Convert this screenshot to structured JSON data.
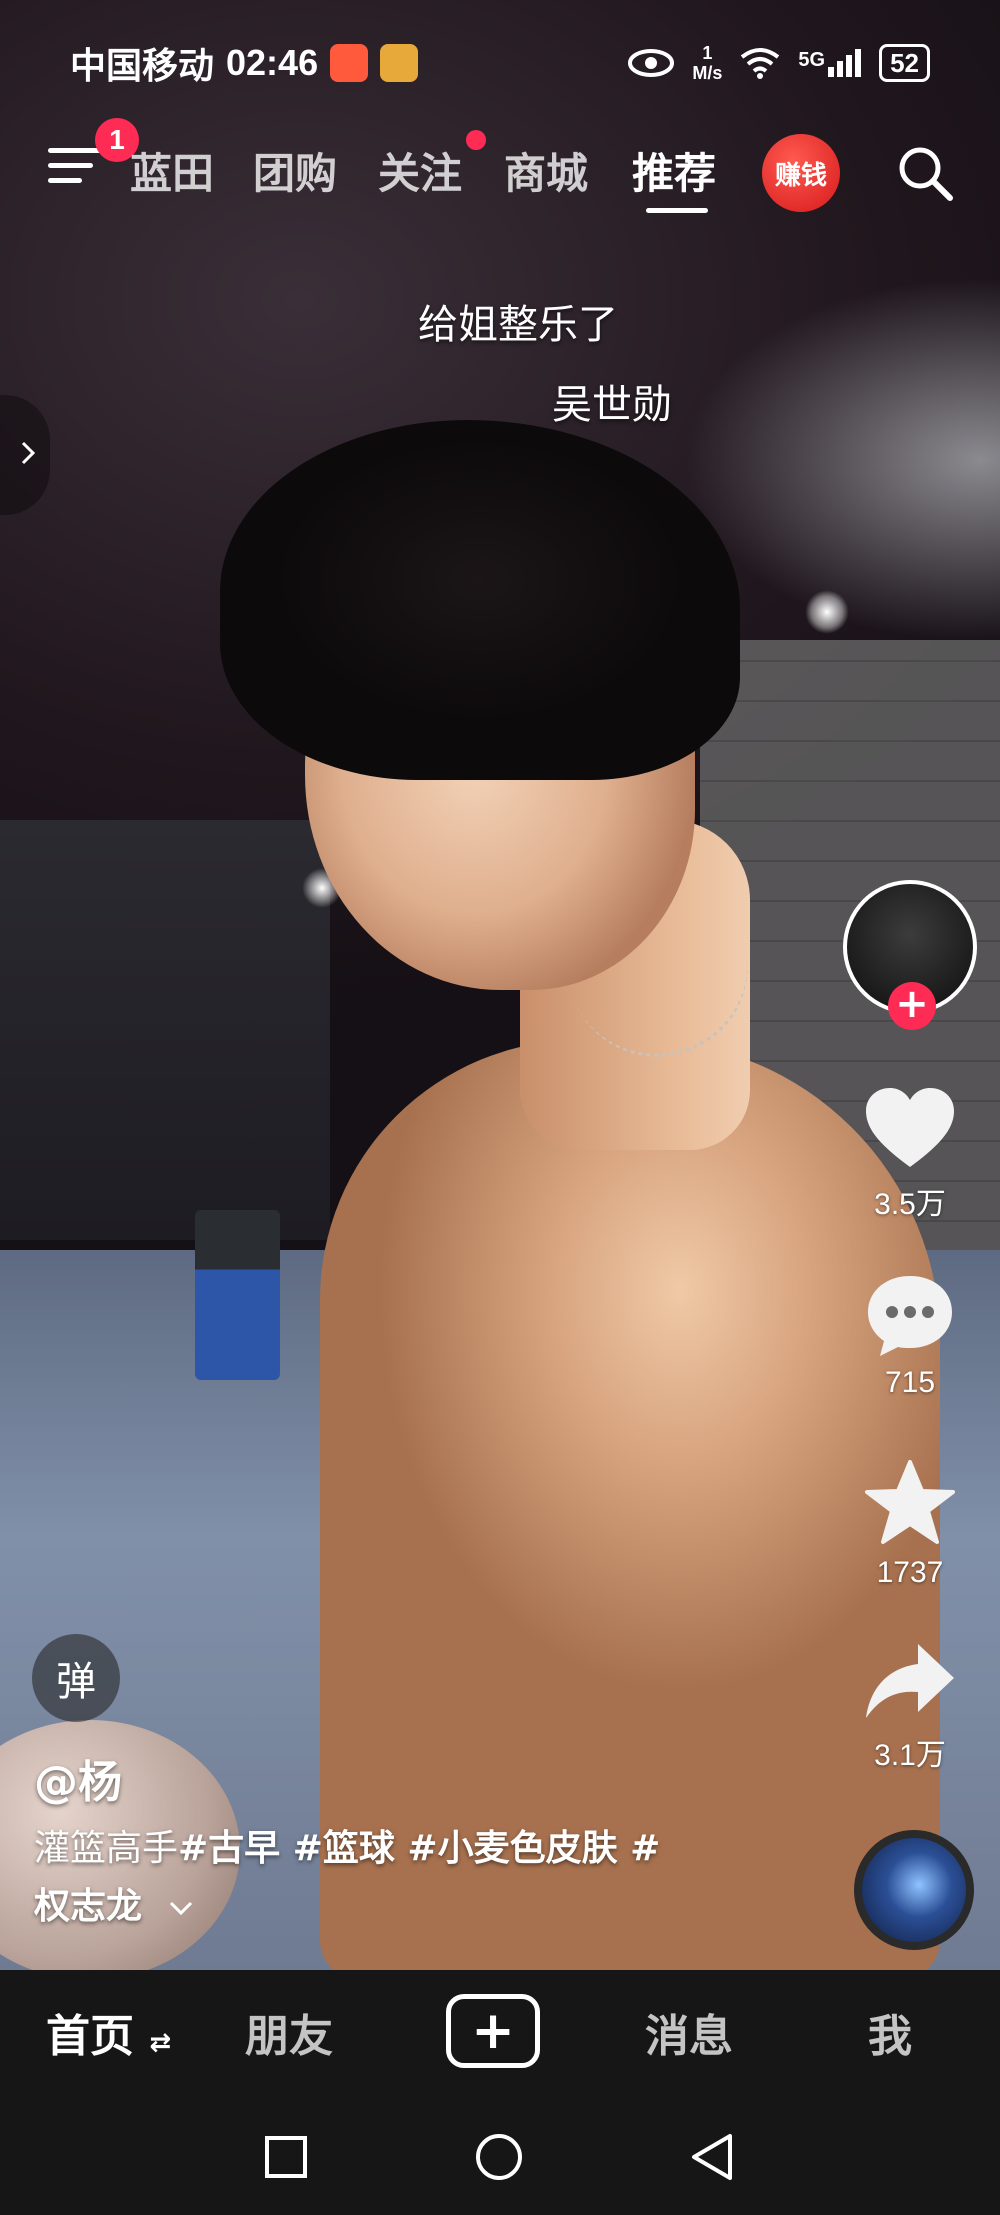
{
  "status_bar": {
    "carrier": "中国移动",
    "time": "02:46",
    "net_speed_value": "1",
    "net_speed_unit": "M/s",
    "network": "5G",
    "battery": "52"
  },
  "top_nav": {
    "menu_badge": "1",
    "tabs": [
      "蓝田",
      "团购",
      "关注",
      "商城",
      "推荐"
    ],
    "active_tab": "推荐",
    "earn_label": "赚钱"
  },
  "captions": {
    "line1": "给姐整乐了",
    "line2": "吴世勋"
  },
  "rail": {
    "like_count": "3.5万",
    "comment_count": "715",
    "favorite_count": "1737",
    "share_count": "3.1万",
    "follow_symbol": "+"
  },
  "info": {
    "danmu_label": "弹",
    "author": "@杨",
    "desc_prefix": "灌篮高手",
    "hashtags": "#古早 #篮球 #小麦色皮肤 #",
    "desc_line2": "权志龙"
  },
  "bottom_tabs": {
    "home": "首页",
    "friends": "朋友",
    "create": "+",
    "messages": "消息",
    "me": "我"
  },
  "colors": {
    "accent": "#fe2c55",
    "bar_bg": "#161616"
  }
}
